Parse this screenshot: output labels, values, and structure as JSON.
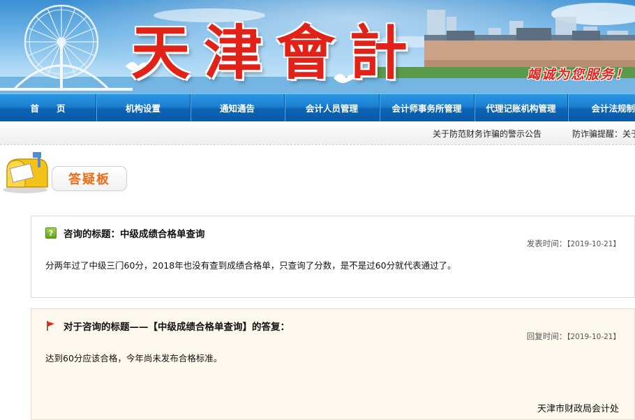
{
  "site": {
    "logo_text": "天津會計",
    "slogan": "竭诚为您服务！"
  },
  "nav": {
    "items": [
      {
        "label": "首　　页"
      },
      {
        "label": "机构设置"
      },
      {
        "label": "通知通告"
      },
      {
        "label": "会计人员管理"
      },
      {
        "label": "会计师事务所管理"
      },
      {
        "label": "代理记账机构管理"
      },
      {
        "label": "会计法规制"
      }
    ]
  },
  "notice": {
    "item1": "关于防范财务诈骗的警示公告",
    "item2": "防诈骗提醒：关于"
  },
  "board": {
    "title": "答疑板"
  },
  "question": {
    "icon": "question-icon",
    "title": "咨询的标题：中级成绩合格单查询",
    "date_label": "发表时间：",
    "date_value": "【2019-10-21】",
    "body": "分两年过了中级三门60分，2018年也没有查到成绩合格单，只查询了分数，是不是过60分就代表通过了。"
  },
  "answer": {
    "icon": "flag-icon",
    "title": "对于咨询的标题——【中级成绩合格单查询】的答复：",
    "date_label": "回复时间：",
    "date_value": "【2019-10-21】",
    "body": "达到60分应该合格，今年尚未发布合格标准。",
    "signature": "天津市财政局会计处"
  },
  "colors": {
    "nav_bg": "#1a7fd0",
    "logo_red": "#e02218",
    "board_orange": "#f06a12",
    "answer_bg": "#fdf8ee"
  }
}
